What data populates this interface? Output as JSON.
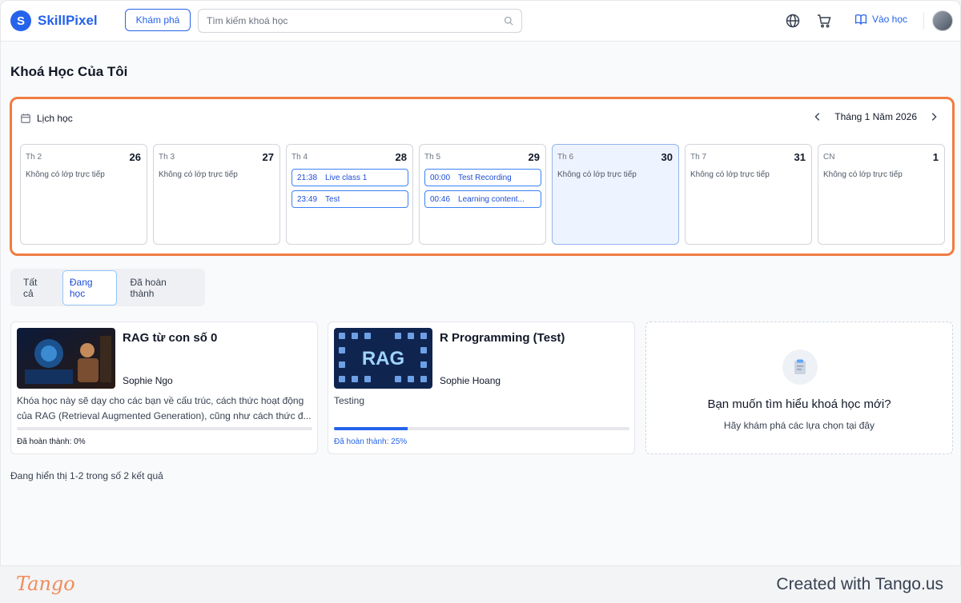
{
  "header": {
    "brand": "SkillPixel",
    "explore_label": "Khám phá",
    "search_placeholder": "Tìm kiếm khoá học",
    "enter_label": "Vào học"
  },
  "page": {
    "title": "Khoá Học Của Tôi"
  },
  "schedule": {
    "title": "Lịch học",
    "month": "Tháng 1 Năm 2026",
    "days": [
      {
        "name": "Th 2",
        "num": "26",
        "empty": "Không có lớp trực tiếp"
      },
      {
        "name": "Th 3",
        "num": "27",
        "empty": "Không có lớp trực tiếp"
      },
      {
        "name": "Th 4",
        "num": "28",
        "events": [
          {
            "time": "21:38",
            "title": "Live class 1"
          },
          {
            "time": "23:49",
            "title": "Test"
          }
        ]
      },
      {
        "name": "Th 5",
        "num": "29",
        "events": [
          {
            "time": "00:00",
            "title": "Test Recording"
          },
          {
            "time": "00:46",
            "title": "Learning content..."
          }
        ]
      },
      {
        "name": "Th 6",
        "num": "30",
        "empty": "Không có lớp trực tiếp",
        "today": true
      },
      {
        "name": "Th 7",
        "num": "31",
        "empty": "Không có lớp trực tiếp"
      },
      {
        "name": "CN",
        "num": "1",
        "empty": "Không có lớp trực tiếp"
      }
    ]
  },
  "tabs": [
    {
      "label": "Tất cả"
    },
    {
      "label": "Đang học",
      "active": true
    },
    {
      "label": "Đã hoàn thành"
    }
  ],
  "courses": [
    {
      "title": "RAG từ con số 0",
      "author": "Sophie Ngo",
      "description": "Khóa học này sẽ dạy cho các bạn về cấu trúc, cách thức hoạt động của RAG (Retrieval Augmented Generation), cũng như cách thức đ...",
      "progress": 0,
      "progress_label": "Đã hoàn thành: 0%"
    },
    {
      "title": "R Programming (Test)",
      "author": "Sophie Hoang",
      "description": "Testing",
      "progress": 0.25,
      "progress_label": "Đã hoàn thành: 25%",
      "thumb_text": "RAG"
    }
  ],
  "new_course": {
    "title": "Bạn muốn tìm hiểu khoá học mới?",
    "subtitle": "Hãy khám phá các lựa chọn tại đây"
  },
  "results_text": "Đang hiển thị 1-2 trong số 2 kết quả",
  "footer": {
    "logo": "Tango",
    "created": "Created with Tango.us"
  },
  "colors": {
    "accent": "#2563eb",
    "highlight": "#f07c41",
    "today_bg": "#eef4ff"
  }
}
